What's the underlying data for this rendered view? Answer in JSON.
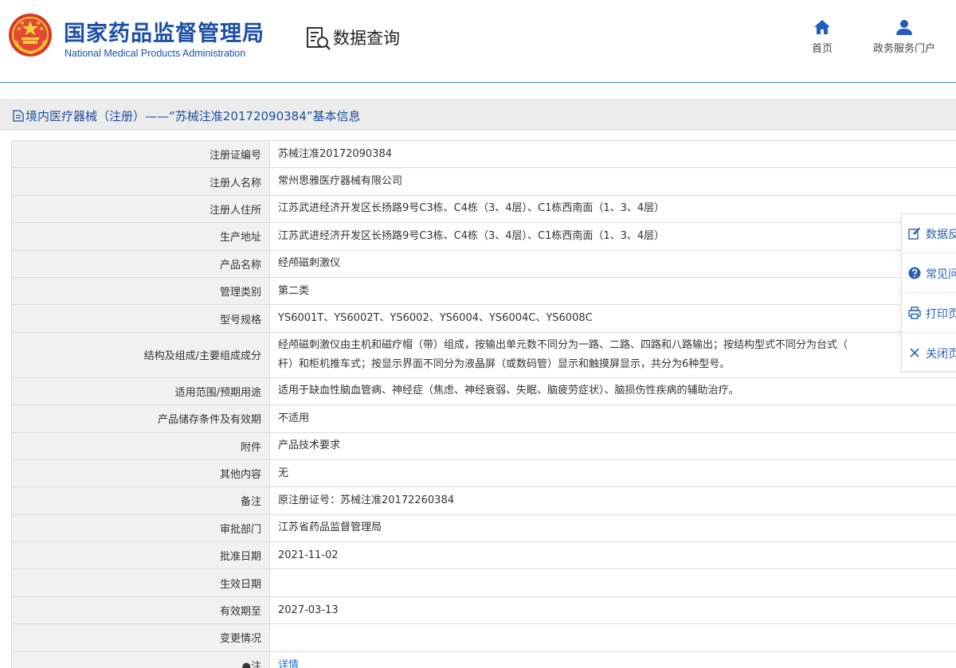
{
  "header": {
    "org_name_cn": "国家药品监督管理局",
    "org_name_en": "National Medical Products Administration",
    "section_title": "数据查询",
    "nav": [
      {
        "label": "首页",
        "icon": "home-icon"
      },
      {
        "label": "政务服务门户",
        "icon": "user-icon"
      }
    ]
  },
  "page": {
    "title": "境内医疗器械（注册）——“苏械注准20172090384”基本信息"
  },
  "table": {
    "rows": [
      {
        "label": "注册证编号",
        "value": "苏械注准20172090384"
      },
      {
        "label": "注册人名称",
        "value": "常州思雅医疗器械有限公司"
      },
      {
        "label": "注册人住所",
        "value": "江苏武进经济开发区长扬路9号C3栋、C4栋（3、4层）、C1栋西南面（1、3、4层）"
      },
      {
        "label": "生产地址",
        "value": "江苏武进经济开发区长扬路9号C3栋、C4栋（3、4层）、C1栋西南面（1、3、4层）"
      },
      {
        "label": "产品名称",
        "value": "经颅磁刺激仪"
      },
      {
        "label": "管理类别",
        "value": "第二类"
      },
      {
        "label": "型号规格",
        "value": "YS6001T、YS6002T、YS6002、YS6004、YS6004C、YS6008C"
      },
      {
        "label": "结构及组成/主要组成成分",
        "value": "经颅磁刺激仪由主机和磁疗帽（带）组成，按输出单元数不同分为一路、二路、四路和八路输出；按结构型式不同分为台式（",
        "value2": "杆）和柜机推车式；按显示界面不同分为液晶屏（或数码管）显示和触摸屏显示，共分为6种型号。"
      },
      {
        "label": "适用范围/预期用途",
        "value": "适用于缺血性脑血管病、神经症（焦虑、神经衰弱、失眠、脑疲劳症状）、脑损伤性疾病的辅助治疗。"
      },
      {
        "label": "产品储存条件及有效期",
        "value": "不适用"
      },
      {
        "label": "附件",
        "value": "产品技术要求"
      },
      {
        "label": "其他内容",
        "value": "无"
      },
      {
        "label": "备注",
        "value": "原注册证号：苏械注准20172260384"
      },
      {
        "label": "审批部门",
        "value": "江苏省药品监督管理局"
      },
      {
        "label": "批准日期",
        "value": "2021-11-02"
      },
      {
        "label": "生效日期",
        "value": ""
      },
      {
        "label": "有效期至",
        "value": "2027-03-13"
      },
      {
        "label": "变更情况",
        "value": ""
      },
      {
        "label": "●注",
        "value": "详情"
      }
    ]
  },
  "side_panel": {
    "items": [
      {
        "label": "数据反馈",
        "icon": "edit-icon"
      },
      {
        "label": "常见问题",
        "icon": "question-icon"
      },
      {
        "label": "打印页面",
        "icon": "print-icon"
      },
      {
        "label": "关闭页面",
        "icon": "close-icon"
      }
    ]
  },
  "colors": {
    "brand_blue": "#1c4fa8",
    "link_blue": "#2860b0",
    "label_bg": "#f1f1f1",
    "title_bar_bg": "#ececec"
  }
}
